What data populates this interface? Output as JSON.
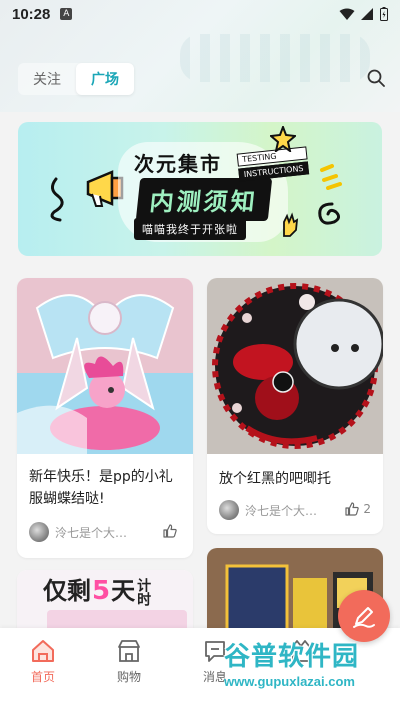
{
  "status_bar": {
    "time": "10:28",
    "notif_letter": "A"
  },
  "tabs": [
    {
      "label": "关注",
      "active": false
    },
    {
      "label": "广场",
      "active": true
    }
  ],
  "banner": {
    "title1": "次元集市",
    "title2": "内测须知",
    "subtitle": "喵喵我终于开张啦",
    "testing_line1": "TESTING",
    "testing_line2": "INSTRUCTIONS"
  },
  "posts": [
    {
      "title": "新年快乐！是pp的小礼服蝴蝶结哒!",
      "author": "泠七是个大…",
      "likes": ""
    },
    {
      "title": "放个红黑的吧唧托",
      "author": "泠七是个大…",
      "likes": "2"
    },
    {
      "overlay_text_1": "仅剩",
      "overlay_text_2": "5",
      "overlay_text_3": "天",
      "overlay_text_4": "计时"
    },
    {}
  ],
  "bottom_nav": [
    {
      "label": "首页",
      "active": true,
      "icon": "home-icon"
    },
    {
      "label": "购物",
      "active": false,
      "icon": "shop-icon"
    },
    {
      "label": "消息",
      "active": false,
      "icon": "message-icon"
    },
    {
      "label": "",
      "active": false,
      "icon": "profile-icon"
    }
  ],
  "watermark": {
    "title": "谷普软件园",
    "url": "www.gupuxlazai.com"
  },
  "colors": {
    "accent": "#1aa6b7",
    "nav_active": "#f26b5b",
    "watermark": "#2fb6c5"
  }
}
